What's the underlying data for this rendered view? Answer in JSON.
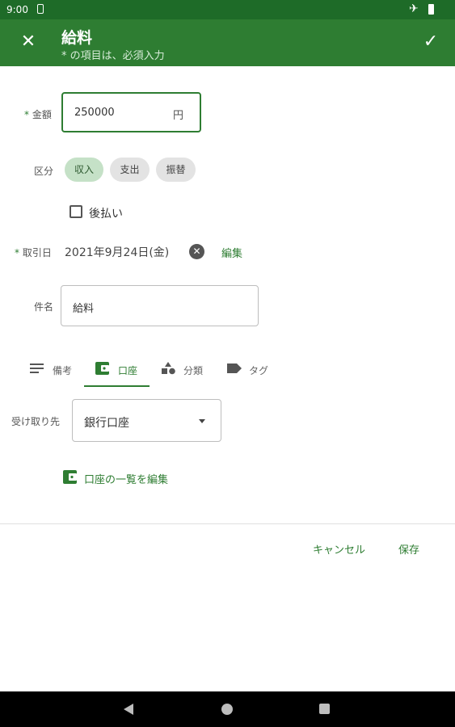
{
  "status_bar": {
    "time": "9:00"
  },
  "app_bar": {
    "title": "給料",
    "subtitle": "* の項目は、必須入力"
  },
  "amount": {
    "label": "金額",
    "value": "250000",
    "unit": "円"
  },
  "category": {
    "label": "区分",
    "options": [
      "収入",
      "支出",
      "振替"
    ],
    "selected": "収入"
  },
  "deferred": {
    "label": "後払い",
    "checked": false
  },
  "date": {
    "label": "取引日",
    "value": "2021年9月24日(金)",
    "edit_label": "編集"
  },
  "name": {
    "label": "件名",
    "value": "給料"
  },
  "tabs": [
    {
      "label": "備考",
      "icon": "notes-icon"
    },
    {
      "label": "口座",
      "icon": "wallet-icon"
    },
    {
      "label": "分類",
      "icon": "category-icon"
    },
    {
      "label": "タグ",
      "icon": "tag-icon"
    }
  ],
  "active_tab": "口座",
  "receiver": {
    "label": "受け取り先",
    "value": "銀行口座"
  },
  "account_edit_label": "口座の一覧を編集",
  "footer": {
    "cancel_label": "キャンセル",
    "save_label": "保存"
  },
  "colors": {
    "primary": "#2e7d32",
    "status_bar": "#1e6b28",
    "chip_selected": "#c5e1c7"
  }
}
